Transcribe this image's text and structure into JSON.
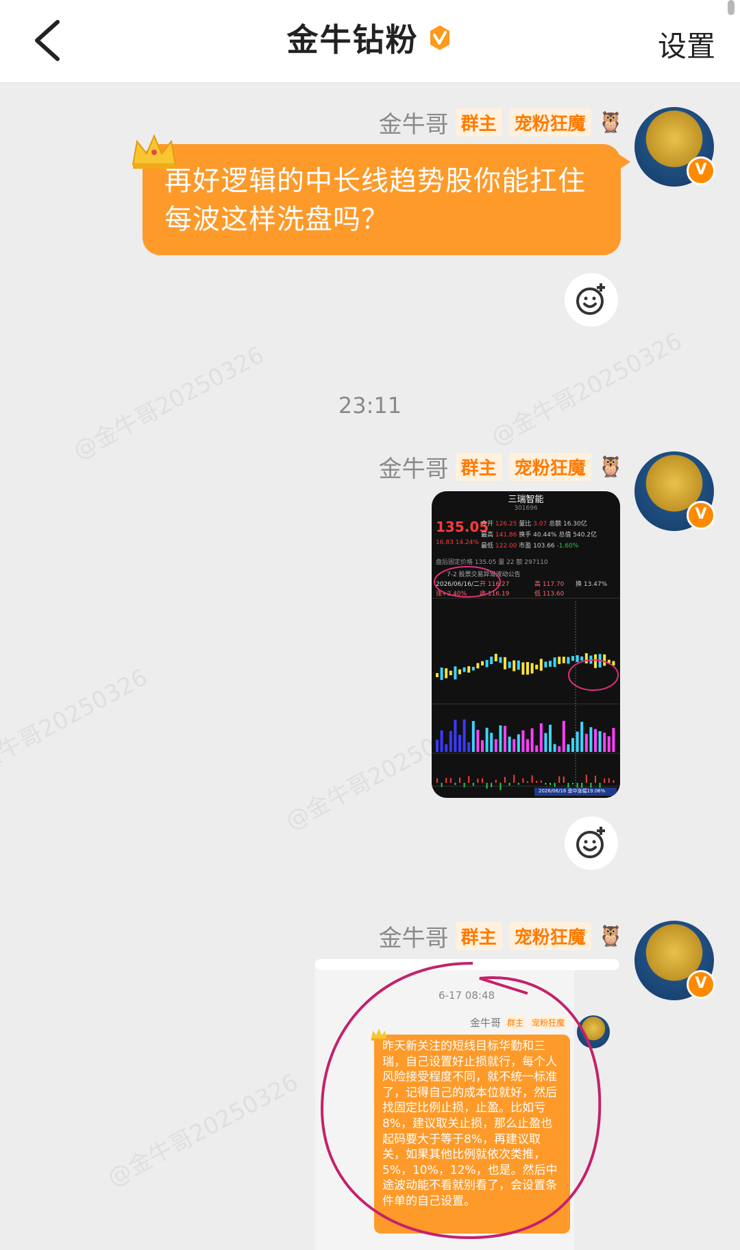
{
  "header": {
    "back_icon": "chevron-left-icon",
    "title": "金牛钻粉",
    "verified_icon": "verified-badge-icon",
    "settings_label": "设置"
  },
  "watermark": "@金牛哥20250326",
  "messages": [
    {
      "sender": "金牛哥",
      "tags": [
        "群主",
        "宠粉狂魔"
      ],
      "text": "再好逻辑的中长线趋势股你能扛住每波这样洗盘吗？"
    },
    {
      "sender": "金牛哥",
      "tags": [
        "群主",
        "宠粉狂魔"
      ],
      "image": {
        "stock_name": "三瑞智能",
        "stock_code": "301696",
        "price": "135.05",
        "change": "16.83 14.24%",
        "rows": [
          [
            "今开",
            "126.25",
            "量比",
            "3.07",
            "总额",
            "16.30亿"
          ],
          [
            "最高",
            "141.86",
            "换手",
            "40.44%",
            "总值",
            "540.2亿"
          ],
          [
            "最低",
            "122.00",
            "市盈",
            "103.66",
            "",
            "-1.60%"
          ]
        ],
        "after_hours": "盘后固定价格  135.05  量  22  额  297110",
        "notice": "7-2 股票交易异常波动公告",
        "date": "2026/06/16/二",
        "day_stats": [
          "开 116.27",
          "高 117.70",
          "换 13.47%",
          "涨+2.40%",
          "收 116.19",
          "低 113.60"
        ],
        "footer": "2026/06/16 盘中涨幅19.06%"
      }
    },
    {
      "sender": "金牛哥",
      "tags": [
        "群主",
        "宠粉狂魔"
      ],
      "quoted": {
        "time": "6-17 08:48",
        "sender": "金牛哥",
        "tags": [
          "群主",
          "宠粉狂魔"
        ],
        "text": "昨天新关注的短线目标华勤和三瑞，自己设置好止损就行，每个人风险接受程度不同，就不统一标准了，记得自己的成本位就好，然后找固定比例止损，止盈。比如亏8%，建议取关止损，那么止盈也起码要大于等于8%，再建议取关，如果其他比例就依次类推，5%，10%，12%，也是。然后中途波动能不看就别看了，会设置条件单的自己设置。"
      }
    }
  ],
  "timestamp": "23:11",
  "icons": {
    "reaction": "add-reaction-icon",
    "crown": "crown-icon",
    "owl": "owl-icon"
  },
  "colors": {
    "bubble": "#fd9a2a",
    "tag_text": "#ff7a00",
    "annotation_circle": "#c4216a"
  }
}
